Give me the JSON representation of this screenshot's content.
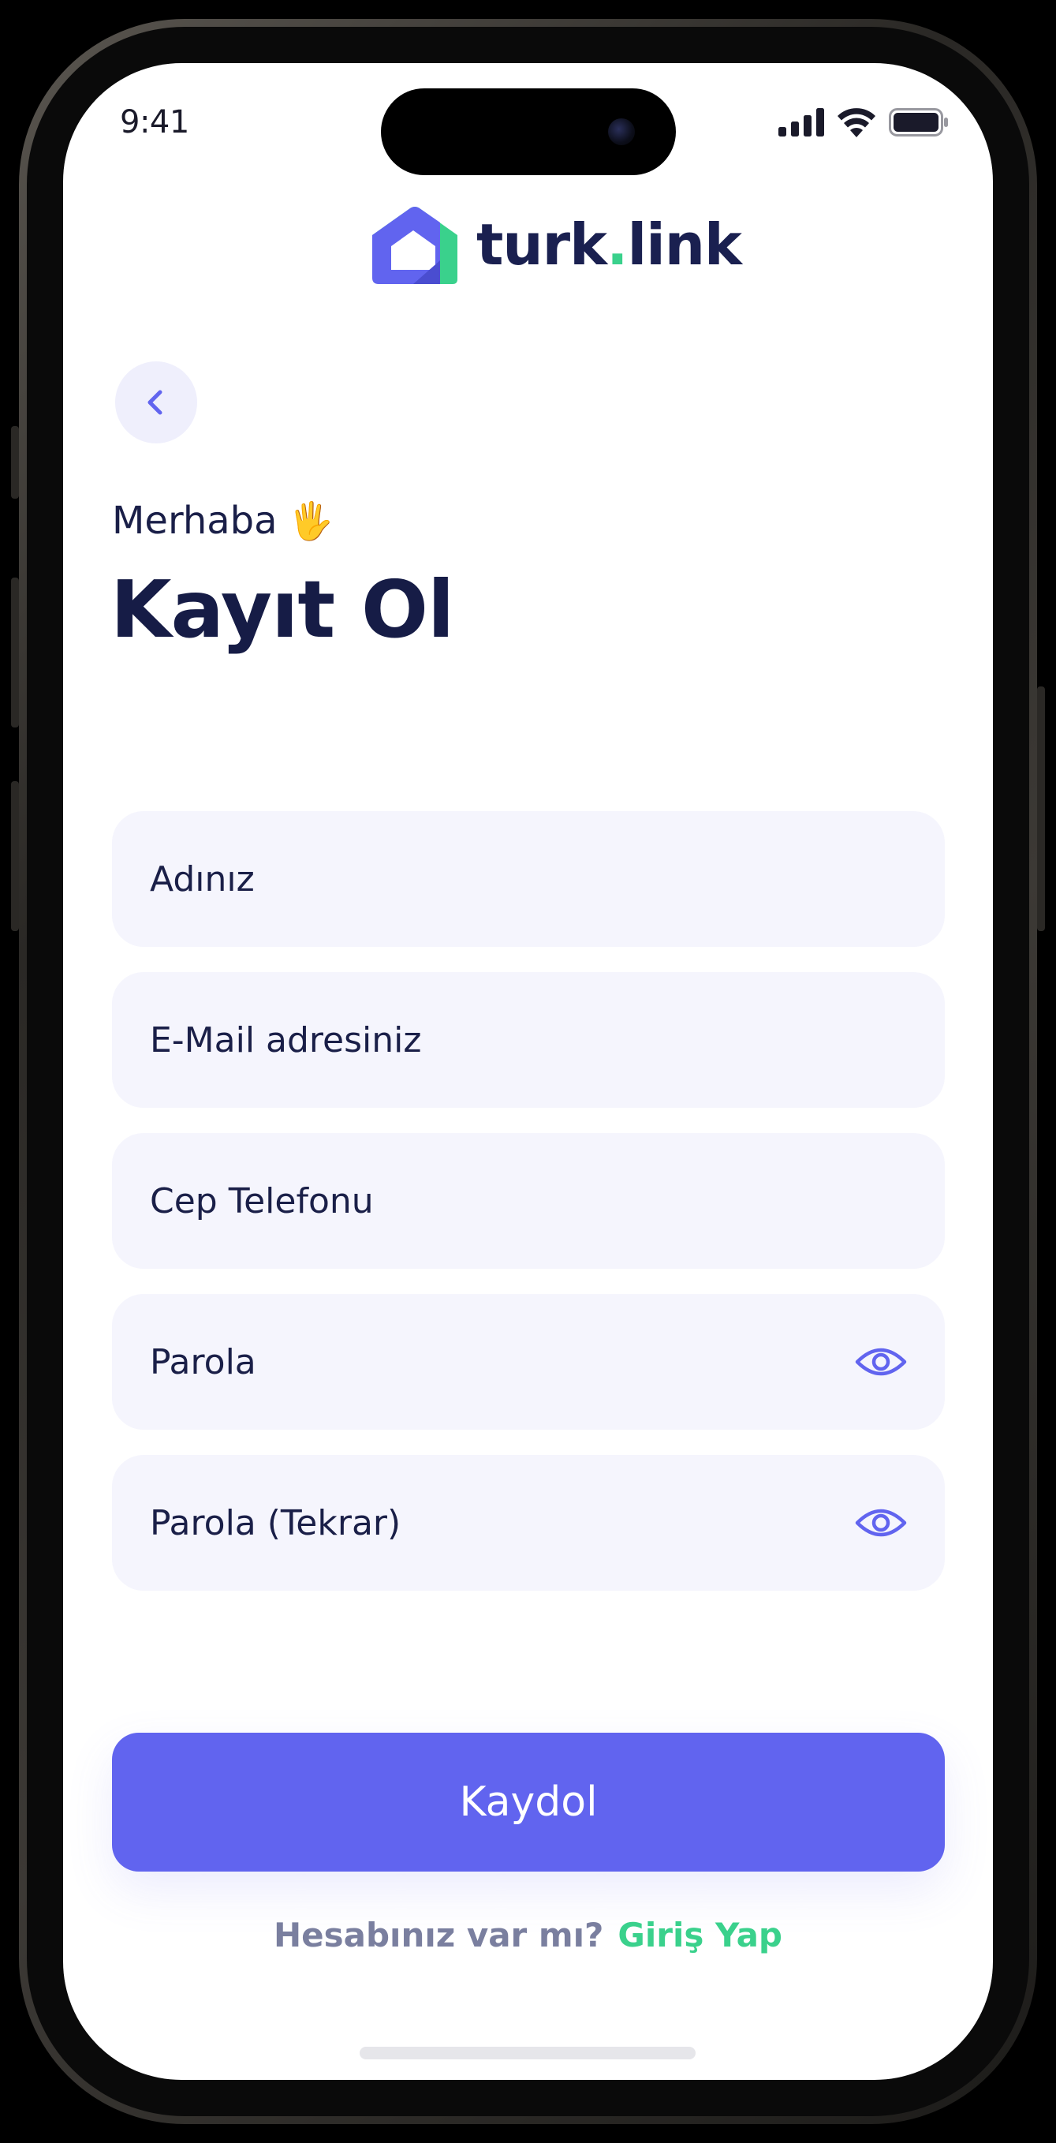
{
  "status_bar": {
    "time": "9:41",
    "icons": [
      "signal-icon",
      "wifi-icon",
      "battery-icon"
    ]
  },
  "brand": {
    "name_part1": "turk",
    "name_dot": ".",
    "name_part2": "link",
    "primary_color": "#6164ef",
    "accent_color": "#3ad18c",
    "text_color": "#161c46"
  },
  "header": {
    "back_icon": "chevron-left-icon",
    "greeting": "Merhaba",
    "greeting_emoji": "🖐",
    "title": "Kayıt Ol"
  },
  "form": {
    "name_placeholder": "Adınız",
    "email_placeholder": "E-Mail adresiniz",
    "phone_placeholder": "Cep Telefonu",
    "password_placeholder": "Parola",
    "password_repeat_placeholder": "Parola (Tekrar)",
    "eye_icon": "eye-icon"
  },
  "actions": {
    "submit_label": "Kaydol",
    "have_account_text": "Hesabınız var mı?",
    "login_link": "Giriş Yap"
  }
}
